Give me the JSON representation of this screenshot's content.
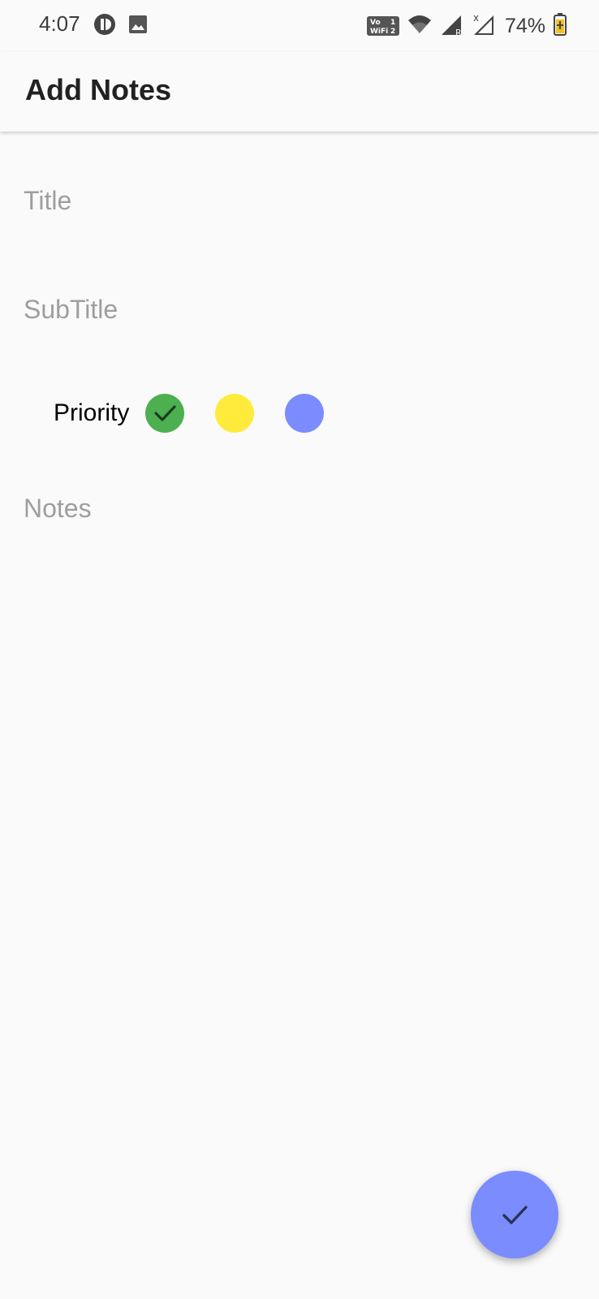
{
  "status_bar": {
    "time": "4:07",
    "battery": "74%",
    "left_icons": [
      "app-notification-icon",
      "image-notification-icon"
    ],
    "right_icons": [
      "vowifi-icon",
      "wifi-icon",
      "signal-roaming-icon",
      "signal-no-service-icon",
      "battery-charging-icon"
    ]
  },
  "app_bar": {
    "title": "Add Notes"
  },
  "form": {
    "title_placeholder": "Title",
    "subtitle_placeholder": "SubTitle",
    "notes_placeholder": "Notes",
    "title_value": "",
    "subtitle_value": "",
    "notes_value": ""
  },
  "priority": {
    "label": "Priority",
    "options": [
      {
        "name": "green",
        "color": "#4caf50",
        "selected": true
      },
      {
        "name": "yellow",
        "color": "#ffeb3b",
        "selected": false
      },
      {
        "name": "blue",
        "color": "#7b8cff",
        "selected": false
      }
    ]
  },
  "fab": {
    "icon": "check-icon",
    "color": "#7b8cff"
  },
  "colors": {
    "background": "#fafafa",
    "accent": "#7b8cff"
  }
}
